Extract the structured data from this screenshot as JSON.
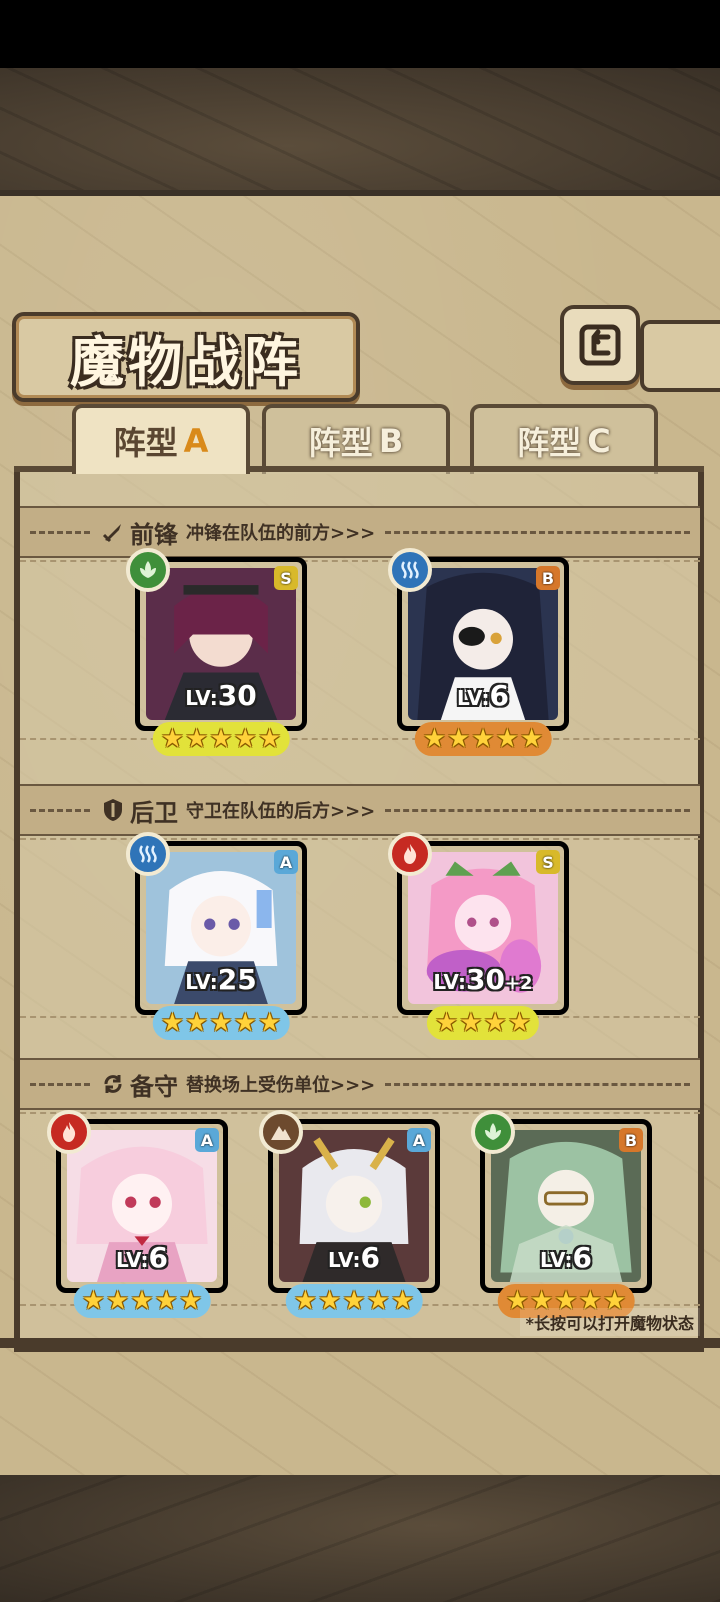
{
  "title": "魔物战阵",
  "back_button": {
    "icon": "return-arrow-icon"
  },
  "tabs": [
    {
      "label": "阵型",
      "letter": "A",
      "active": true
    },
    {
      "label": "阵型",
      "letter": "B",
      "active": false
    },
    {
      "label": "阵型",
      "letter": "C",
      "active": false
    }
  ],
  "sections": {
    "front": {
      "name": "前锋",
      "desc": "冲锋在队伍的前方>>>",
      "icon": "sword-icon"
    },
    "rear": {
      "name": "后卫",
      "desc": "守卫在队伍的后方>>>",
      "icon": "shield-icon"
    },
    "reserve": {
      "name": "备守",
      "desc": "替换场上受伤单位>>>",
      "icon": "swap-icon"
    }
  },
  "units": {
    "front": [
      {
        "element": "wind",
        "rarity": "S",
        "lv_label": "LV:",
        "level": "30",
        "stars": 5,
        "frame": "#e2e23a"
      },
      {
        "element": "water",
        "rarity": "B",
        "lv_label": "LV:",
        "level": "6",
        "stars": 5,
        "frame": "#e08a35"
      }
    ],
    "rear": [
      {
        "element": "water",
        "rarity": "A",
        "lv_label": "LV:",
        "level": "25",
        "stars": 5,
        "frame": "#7fc6e8"
      },
      {
        "element": "fire",
        "rarity": "S",
        "lv_label": "LV:",
        "level": "30",
        "plus": "+2",
        "stars": 4,
        "frame": "#e2e23a"
      }
    ],
    "reserve": [
      {
        "element": "fire",
        "rarity": "A",
        "lv_label": "LV:",
        "level": "6",
        "stars": 5,
        "frame": "#7fc6e8"
      },
      {
        "element": "earth",
        "rarity": "A",
        "lv_label": "LV:",
        "level": "6",
        "stars": 5,
        "frame": "#7fc6e8"
      },
      {
        "element": "wind",
        "rarity": "B",
        "lv_label": "LV:",
        "level": "6",
        "stars": 5,
        "frame": "#e08a35"
      }
    ]
  },
  "hint": "*长按可以打开魔物状态",
  "colors": {
    "wind": "#3f8f3a",
    "water": "#2f74b8",
    "fire": "#c62a22",
    "earth": "#6d4a2e"
  }
}
